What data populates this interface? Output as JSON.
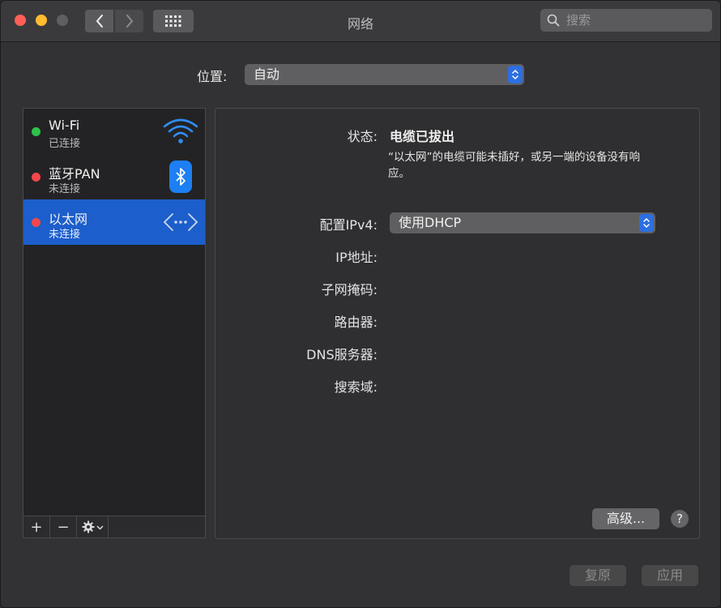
{
  "window": {
    "title": "网络",
    "search_placeholder": "搜索"
  },
  "location": {
    "label": "位置:",
    "value": "自动"
  },
  "services": [
    {
      "name": "Wi-Fi",
      "status": "已连接",
      "dot_color": "#2ec24a",
      "icon": "wifi-icon"
    },
    {
      "name": "蓝牙PAN",
      "status": "未连接",
      "dot_color": "#f2474b",
      "icon": "bluetooth-icon"
    },
    {
      "name": "以太网",
      "status": "未连接",
      "dot_color": "#f2474b",
      "icon": "ethernet-icon",
      "selected": true
    }
  ],
  "sidebar_footer": {
    "add": "+",
    "remove": "−",
    "action_icon": "gear-icon"
  },
  "detail": {
    "status_label": "状态:",
    "status_value": "电缆已拔出",
    "status_description": "“以太网”的电缆可能未插好，或另一端的设备没有响应。",
    "config_label": "配置IPv4:",
    "config_value": "使用DHCP",
    "ip_label": "IP地址:",
    "subnet_label": "子网掩码:",
    "router_label": "路由器:",
    "dns_label": "DNS服务器:",
    "search_domain_label": "搜索域:",
    "advanced_button": "高级...",
    "help": "?"
  },
  "buttons": {
    "revert": "复原",
    "apply": "应用"
  },
  "colors": {
    "accent": "#1c5ecb",
    "connected": "#2ec24a",
    "disconnected": "#f2474b"
  }
}
